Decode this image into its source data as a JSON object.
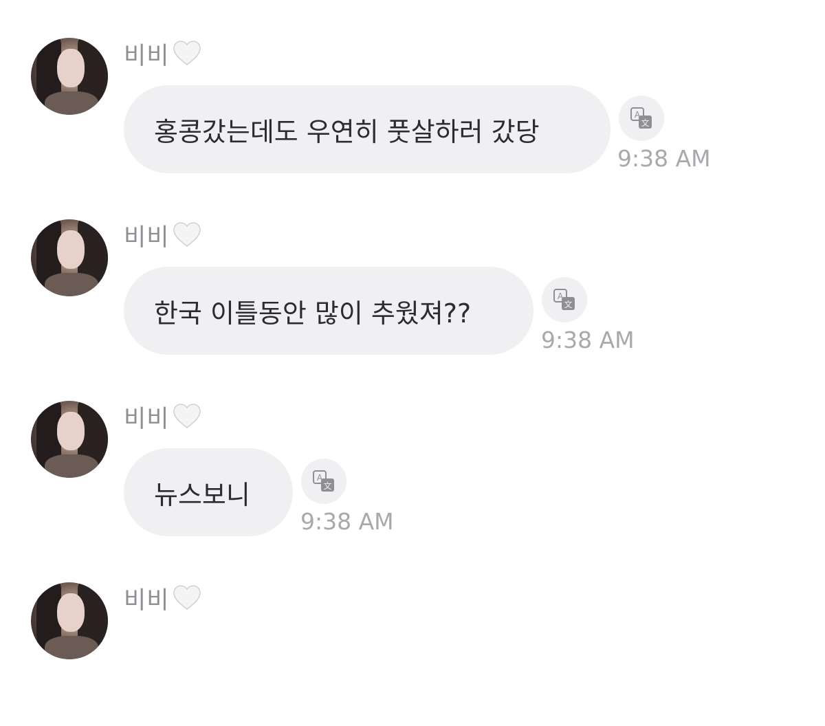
{
  "messages": [
    {
      "sender": "비비",
      "text": "홍콩갔는데도 우연히 풋살하러 갔당",
      "time": "9:38 AM"
    },
    {
      "sender": "비비",
      "text": "한국 이틀동안 많이 추웠져??",
      "time": "9:38 AM"
    },
    {
      "sender": "비비",
      "text": "뉴스보니",
      "time": "9:38 AM"
    },
    {
      "sender": "비비"
    }
  ],
  "icons": {
    "heart": "white-heart-icon",
    "translate": "translate-icon"
  },
  "colors": {
    "bubble": "#f0f0f3",
    "text": "#2c2c2e",
    "name": "#8e8e93",
    "time": "#a8a8ad"
  }
}
